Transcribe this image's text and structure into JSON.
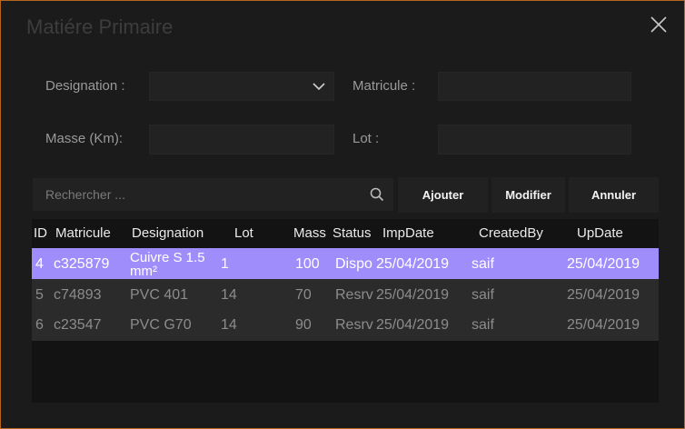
{
  "window": {
    "title": "Matiére Primaire"
  },
  "form": {
    "designation_label": "Designation :",
    "designation_value": "",
    "matricule_label": "Matricule :",
    "matricule_value": "",
    "masse_label": "Masse (Km):",
    "masse_value": "",
    "lot_label": "Lot :",
    "lot_value": ""
  },
  "search": {
    "placeholder": "Rechercher ...",
    "value": ""
  },
  "buttons": {
    "ajouter": "Ajouter",
    "modifier": "Modifier",
    "annuler": "Annuler"
  },
  "table": {
    "columns": [
      "ID",
      "Matricule",
      "Designation",
      "Lot",
      "Mass",
      "Status",
      "ImpDate",
      "CreatedBy",
      "UpDate"
    ],
    "rows": [
      {
        "id": "4",
        "matricule": "c325879",
        "designation": "Cuivre S 1.5 mm²",
        "lot": "1",
        "mass": "100",
        "status": "Dispo",
        "impdate": "25/04/2019",
        "createdby": "saif",
        "update": "25/04/2019",
        "selected": true
      },
      {
        "id": "5",
        "matricule": "c74893",
        "designation": "PVC 401",
        "lot": "14",
        "mass": "70",
        "status": "Resrv",
        "impdate": "25/04/2019",
        "createdby": "saif",
        "update": "25/04/2019",
        "selected": false
      },
      {
        "id": "6",
        "matricule": "c23547",
        "designation": "PVC G70",
        "lot": "14",
        "mass": "90",
        "status": "Resrv",
        "impdate": "25/04/2019",
        "createdby": "saif",
        "update": "25/04/2019",
        "selected": false
      }
    ]
  },
  "colors": {
    "accent_border": "#b5651d",
    "selected_row": "#9f8dfb",
    "background": "#1b1b1b"
  },
  "icons": {
    "close": "close-icon",
    "dropdown": "chevron-down-icon",
    "search": "search-icon"
  }
}
